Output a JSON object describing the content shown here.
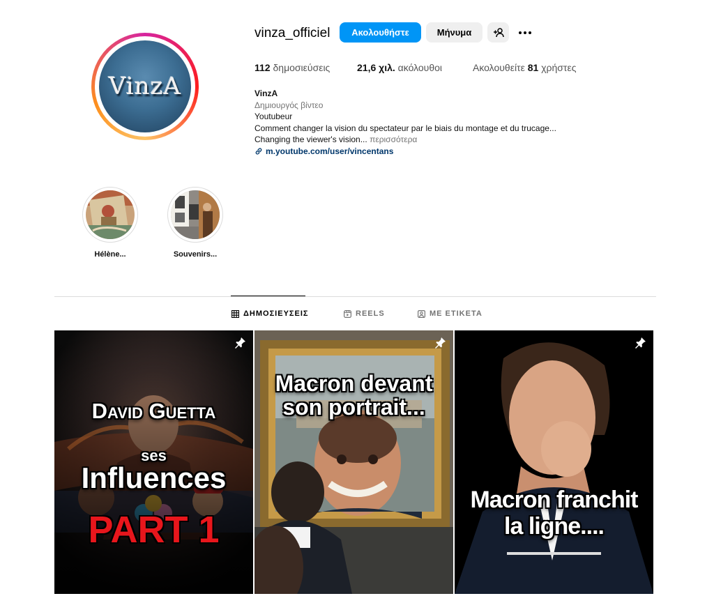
{
  "profile": {
    "username": "vinza_officiel",
    "avatar_text": "VinzA",
    "follow_label": "Ακολουθήστε",
    "message_label": "Μήνυμα"
  },
  "stats": {
    "posts_count": "112",
    "posts_label": "δημοσιεύσεις",
    "followers_count": "21,6 χιλ.",
    "followers_label": "ακόλουθοι",
    "following_prefix": "Ακολουθείτε",
    "following_count": "81",
    "following_suffix": "χρήστες"
  },
  "bio": {
    "name": "VinzA",
    "category": "Δημιουργός βίντεο",
    "line1": "Youtubeur",
    "line2": "Comment changer la vision du spectateur par le biais du montage et du trucage...",
    "line3": "Changing the viewer's vision...",
    "more": "περισσότερα",
    "link": "m.youtube.com/user/vincentans"
  },
  "highlights": [
    {
      "label": "Hélène..."
    },
    {
      "label": "Souvenirs..."
    }
  ],
  "tabs": [
    {
      "label": "ΔΗΜΟΣΙΕΥΣΕΙΣ",
      "icon": "grid-icon",
      "active": true
    },
    {
      "label": "REELS",
      "icon": "reels-icon",
      "active": false
    },
    {
      "label": "ΜΕ ΕΤΙΚΕΤΑ",
      "icon": "tagged-icon",
      "active": false
    }
  ],
  "posts": [
    {
      "line1": "David Guetta",
      "line2": "ses",
      "line3": "Influences",
      "line4": "PART 1"
    },
    {
      "line1": "Macron devant",
      "line2": "son portrait..."
    },
    {
      "line1": "Macron franchit",
      "line2": "la ligne...."
    }
  ],
  "colors": {
    "accent": "#0095f6",
    "link": "#00376b",
    "part_red": "#e8161c"
  }
}
